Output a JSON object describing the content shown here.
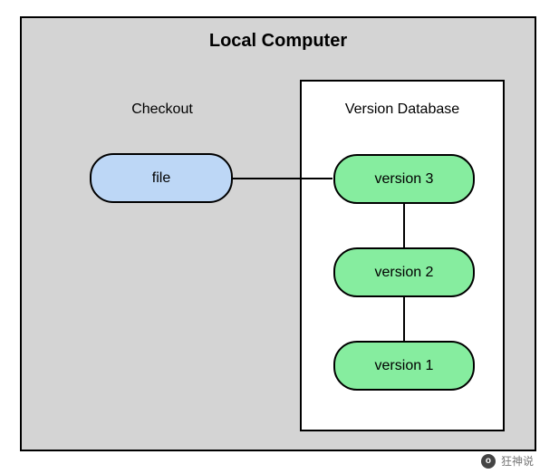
{
  "title": "Local Computer",
  "checkout": {
    "label": "Checkout",
    "file_label": "file"
  },
  "database": {
    "label": "Version Database",
    "versions": {
      "v3": "version 3",
      "v2": "version 2",
      "v1": "version 1"
    }
  },
  "watermark": {
    "icon_text": "o",
    "text": "狂神说"
  }
}
